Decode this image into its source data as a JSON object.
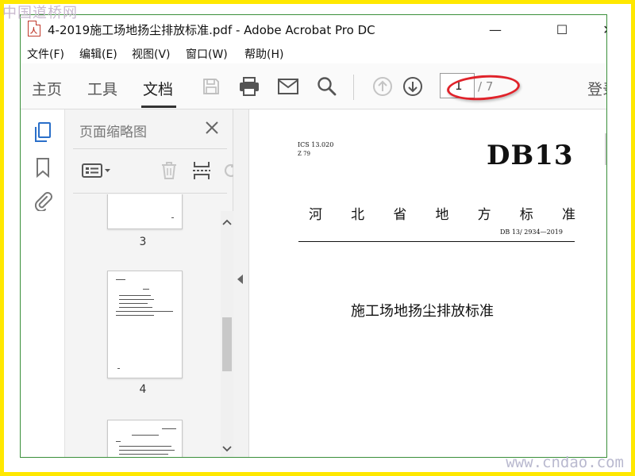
{
  "watermarks": {
    "top": "中国道桥网",
    "bottom": "www.cndao.com"
  },
  "window": {
    "title": "4-2019施工场地扬尘排放标准.pdf - Adobe Acrobat Pro DC",
    "file_icon": "pdf-file-icon",
    "controls": {
      "minimize": "—",
      "maximize": "☐",
      "close": "✕"
    }
  },
  "menu": {
    "items": [
      {
        "label": "文件(F)"
      },
      {
        "label": "编辑(E)"
      },
      {
        "label": "视图(V)"
      },
      {
        "label": "窗口(W)"
      },
      {
        "label": "帮助(H)"
      }
    ]
  },
  "toolbar": {
    "tabs": [
      {
        "label": "主页"
      },
      {
        "label": "工具"
      },
      {
        "label": "文档",
        "active": true
      }
    ],
    "icons": [
      "save-icon",
      "print-icon",
      "mail-icon",
      "search-icon",
      "prev-page-icon",
      "next-page-icon"
    ],
    "page_current": "1",
    "page_total": "/ 7",
    "login_label": "登录",
    "highlight_color": "#e0222a"
  },
  "left_rail": {
    "icons": [
      "page-thumbnails-icon",
      "bookmark-icon",
      "attachment-icon"
    ],
    "accent": "#2a6fc9"
  },
  "thumbnail_panel": {
    "title": "页面缩略图",
    "tools": [
      "thumbnail-options-icon",
      "delete-page-icon",
      "extract-page-icon",
      "rotate-page-icon"
    ],
    "pages": [
      {
        "number": "3"
      },
      {
        "number": "4"
      }
    ]
  },
  "document": {
    "ics_code": "ICS 13.020",
    "classification": "Z 79",
    "header_code": "DB13",
    "standard_type_chars": [
      "河",
      "北",
      "省",
      "地",
      "方",
      "标",
      "准"
    ],
    "standard_number": "DB 13/ 2934—2019",
    "title": "施工场地扬尘排放标准"
  }
}
